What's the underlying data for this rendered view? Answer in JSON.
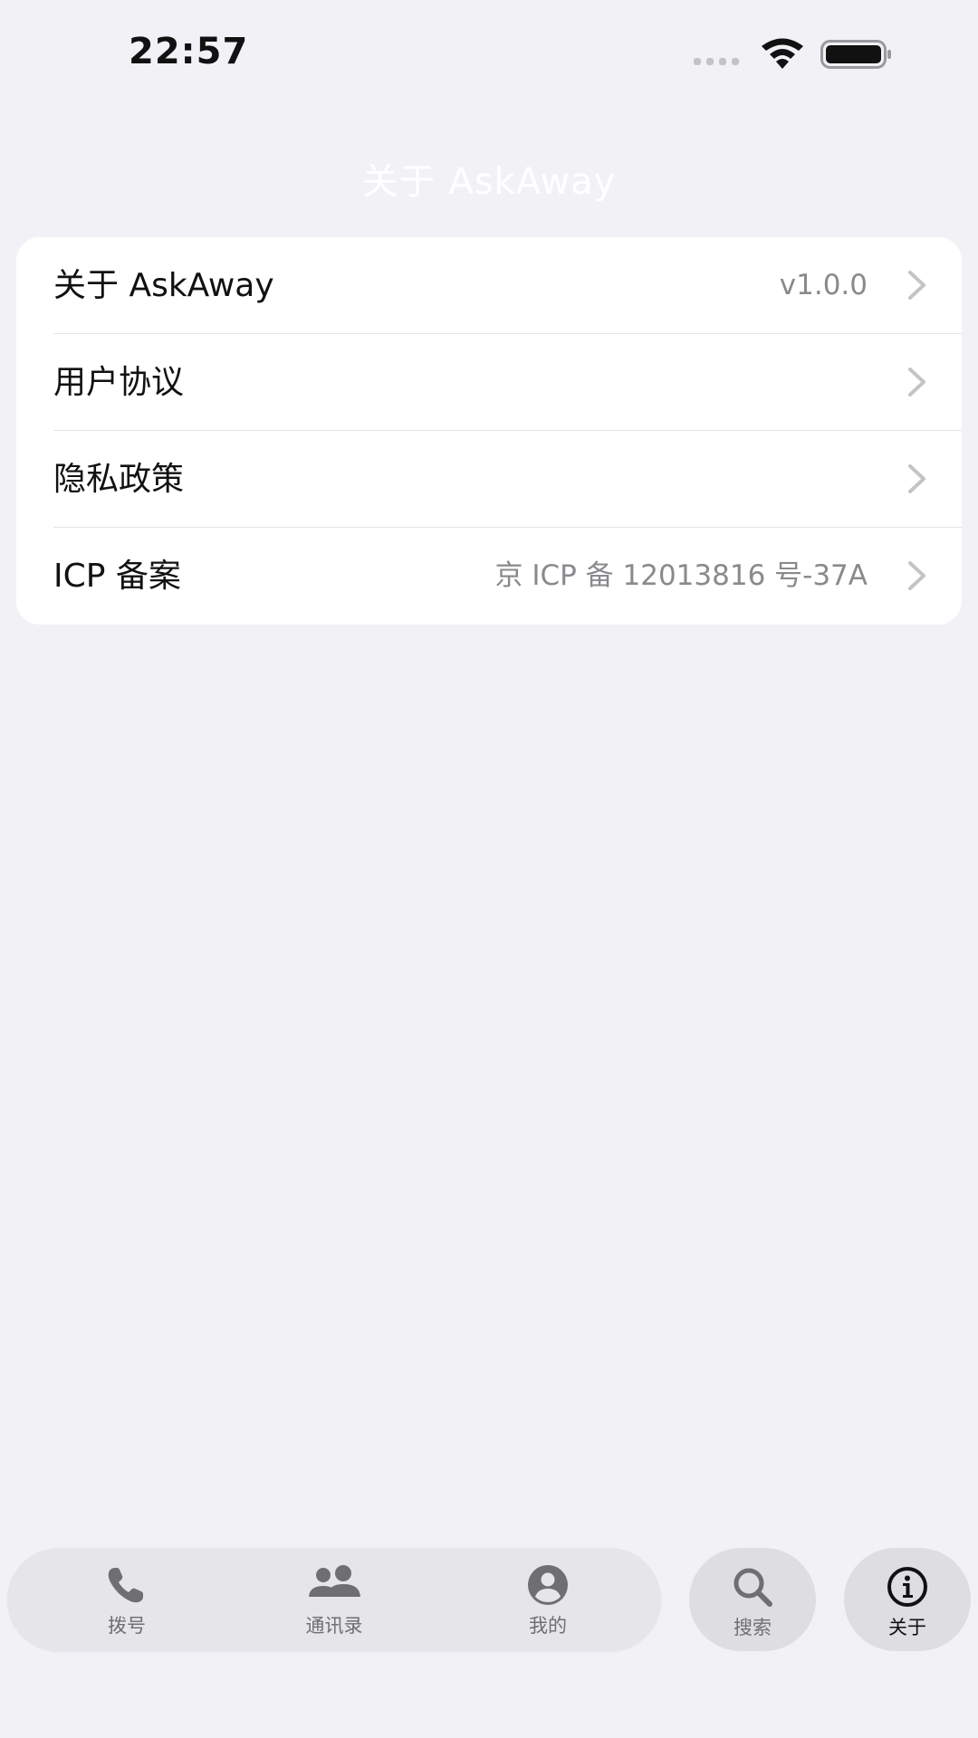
{
  "status_bar": {
    "time": "22:57"
  },
  "nav": {
    "title": "关于 AskAway"
  },
  "settings": {
    "rows": [
      {
        "label": "关于 AskAway",
        "value": "v1.0.0"
      },
      {
        "label": "用户协议",
        "value": ""
      },
      {
        "label": "隐私政策",
        "value": ""
      },
      {
        "label": "ICP 备案",
        "value": "京 ICP 备 12013816 号-37A"
      }
    ]
  },
  "tabs": [
    {
      "label": "拨号",
      "icon": "phone-icon"
    },
    {
      "label": "通讯录",
      "icon": "contacts-icon"
    },
    {
      "label": "我的",
      "icon": "profile-icon"
    },
    {
      "label": "搜索",
      "icon": "search-icon"
    },
    {
      "label": "关于",
      "icon": "info-icon",
      "active": true
    }
  ],
  "colors": {
    "background": "#f2f1f6",
    "card": "#ffffff",
    "secondary_text": "#8a8a8e",
    "chevron": "#c4c4c7",
    "tab_inactive": "#6e6e73",
    "tab_active": "#111111"
  }
}
